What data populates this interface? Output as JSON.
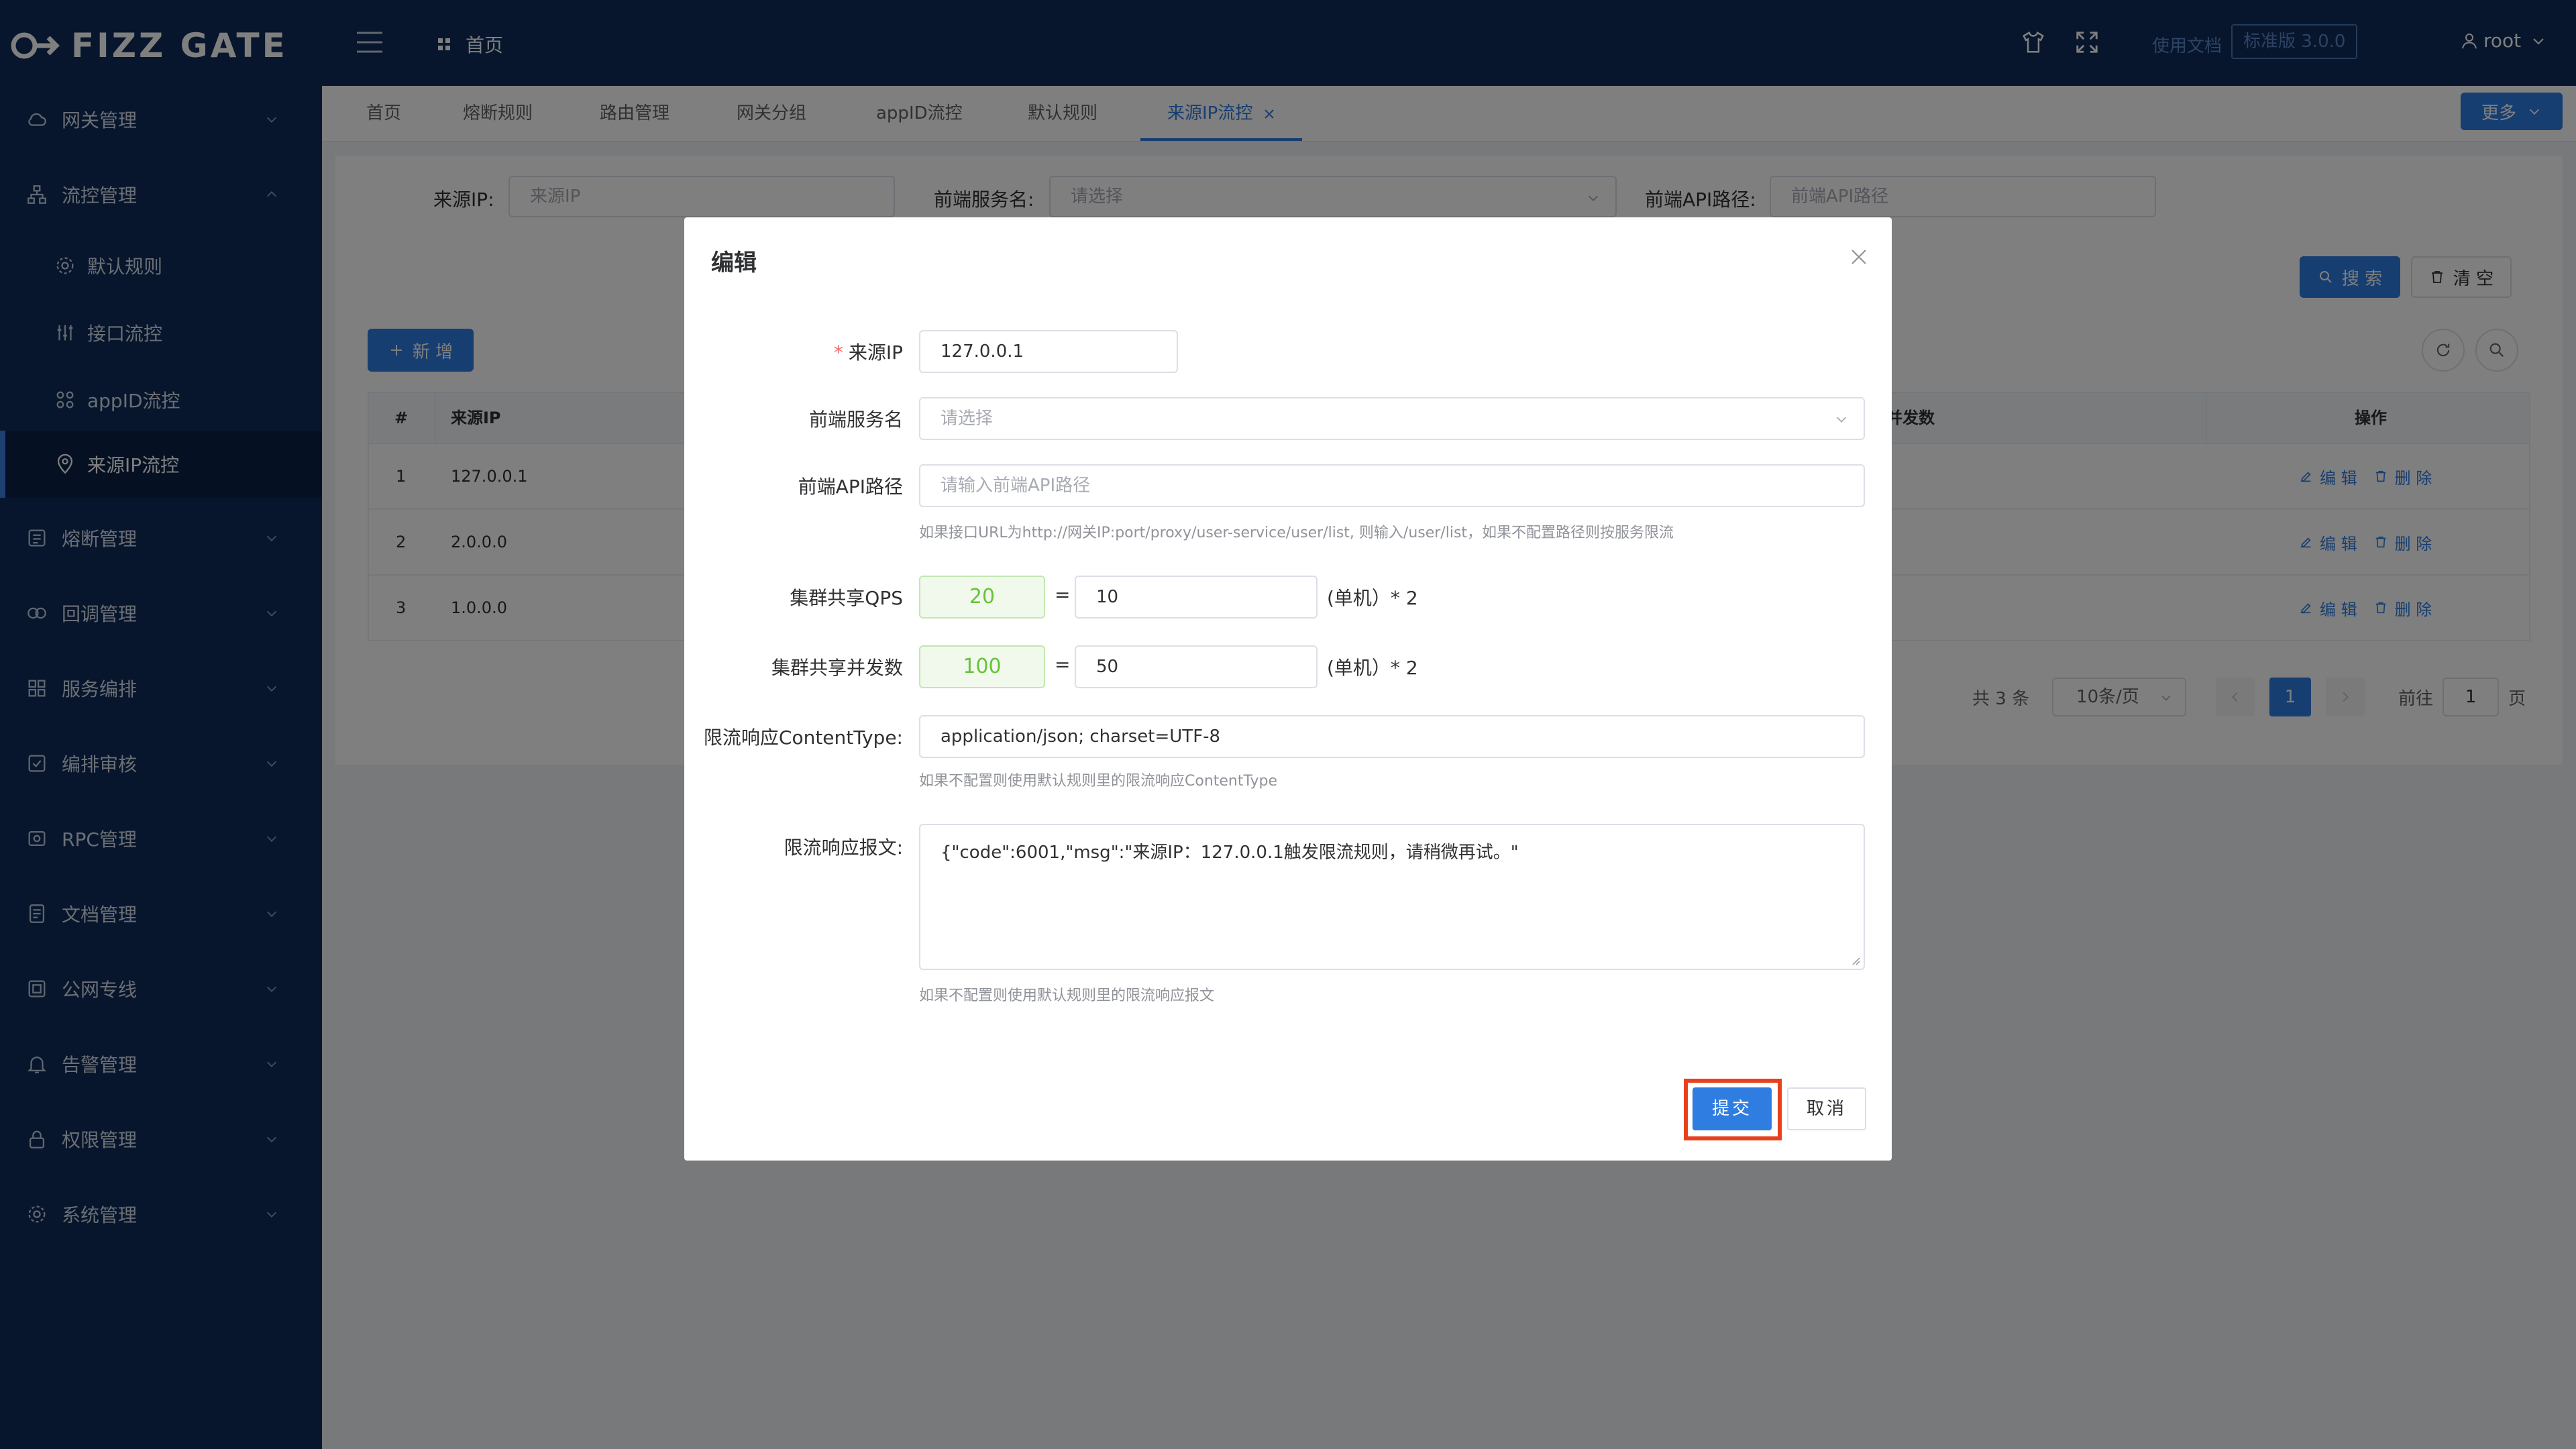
{
  "app": {
    "logo_text": "FIZZ GATE"
  },
  "header": {
    "breadcrumb": "首页",
    "docs_link": "使用文档",
    "version": "标准版 3.0.0",
    "user": "root"
  },
  "sidebar": {
    "items": [
      {
        "label": "网关管理",
        "icon": "cloud-icon"
      },
      {
        "label": "流控管理",
        "icon": "org-chart-icon",
        "expanded": true
      },
      {
        "label": "默认规则",
        "icon": "gear-icon"
      },
      {
        "label": "接口流控",
        "icon": "sliders-icon"
      },
      {
        "label": "appID流控",
        "icon": "grid-icon"
      },
      {
        "label": "来源IP流控",
        "icon": "location-icon",
        "active": true
      },
      {
        "label": "熔断管理",
        "icon": "fuse-icon"
      },
      {
        "label": "回调管理",
        "icon": "loop-icon"
      },
      {
        "label": "服务编排",
        "icon": "apps-icon"
      },
      {
        "label": "编排审核",
        "icon": "audit-icon"
      },
      {
        "label": "RPC管理",
        "icon": "rpc-icon"
      },
      {
        "label": "文档管理",
        "icon": "document-icon"
      },
      {
        "label": "公网专线",
        "icon": "network-icon"
      },
      {
        "label": "告警管理",
        "icon": "bell-icon"
      },
      {
        "label": "权限管理",
        "icon": "lock-icon"
      },
      {
        "label": "系统管理",
        "icon": "settings-icon"
      }
    ]
  },
  "tabs": [
    "首页",
    "熔断规则",
    "路由管理",
    "网关分组",
    "appID流控",
    "默认规则",
    "来源IP流控"
  ],
  "more_button": "更多",
  "filters": {
    "source_ip_label": "来源IP:",
    "source_ip_placeholder": "来源IP",
    "service_label": "前端服务名:",
    "service_placeholder": "请选择",
    "api_path_label": "前端API路径:",
    "api_path_placeholder": "前端API路径",
    "search_button": "搜 索",
    "clear_button": "清 空"
  },
  "add_button": "新 增",
  "table": {
    "headers": [
      "#",
      "来源IP",
      "并发数",
      "操作"
    ],
    "rows": [
      {
        "index": "1",
        "ip": "127.0.0.1"
      },
      {
        "index": "2",
        "ip": "2.0.0.0"
      },
      {
        "index": "3",
        "ip": "1.0.0.0"
      }
    ],
    "edit_label": "编 辑",
    "delete_label": "删 除"
  },
  "pagination": {
    "total": "共 3 条",
    "page_size": "10条/页",
    "current": "1",
    "goto_label": "前往",
    "goto_value": "1",
    "page_suffix": "页"
  },
  "dialog": {
    "title": "编辑",
    "source_ip_label": "来源IP",
    "source_ip_value": "127.0.0.1",
    "service_label": "前端服务名",
    "service_placeholder": "请选择",
    "api_path_label": "前端API路径",
    "api_path_placeholder": "请输入前端API路径",
    "api_path_hint": "如果接口URL为http://网关IP:port/proxy/user-service/user/list, 则输入/user/list，如果不配置路径则按服务限流",
    "qps_label": "集群共享QPS",
    "qps_total": "20",
    "qps_single": "10",
    "concurrency_label": "集群共享并发数",
    "concurrency_total": "100",
    "concurrency_single": "50",
    "equals": "=",
    "single_suffix": "(单机）* 2",
    "content_type_label": "限流响应ContentType:",
    "content_type_value": "application/json; charset=UTF-8",
    "content_type_hint": "如果不配置则使用默认规则里的限流响应ContentType",
    "response_label": "限流响应报文:",
    "response_value": "{\"code\":6001,\"msg\":\"来源IP：127.0.0.1触发限流规则，请稍微再试。\"",
    "response_hint": "如果不配置则使用默认规则里的限流响应报文",
    "submit_button": "提交",
    "cancel_button": "取消"
  },
  "colors": {
    "sidebar_bg": "#0e2d5b",
    "primary": "#2f7de1",
    "highlight": "#e8401c",
    "success": "#67c23a"
  }
}
